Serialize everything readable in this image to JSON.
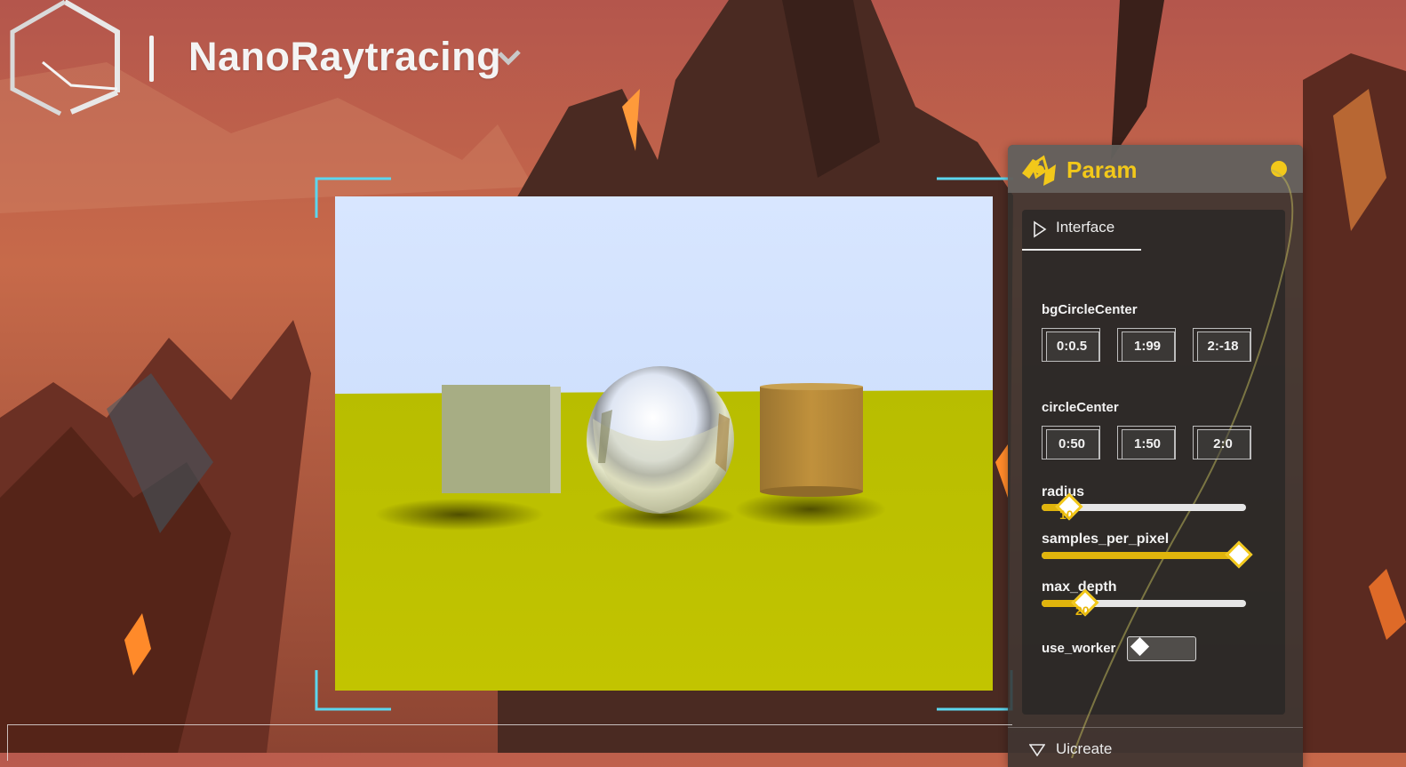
{
  "header": {
    "app_title": "NanoRaytracing",
    "logo_icon": "hexagon-logo-icon",
    "menu_icon": "chevron-down-icon"
  },
  "viewport": {
    "scene_objects": [
      "cube",
      "mirror-sphere",
      "cylinder"
    ],
    "colors": {
      "sky_top": "#d5e4ff",
      "sky_bottom": "#c2d6f8",
      "ground": "#bcc200",
      "cube": "#a6ad82",
      "cylinder": "#b58c3c",
      "frame_accent": "#5cd6ee"
    }
  },
  "param_panel": {
    "title": "Param",
    "icon": "param-node-icon",
    "accent_color": "#f2c81a",
    "tab": {
      "label": "Interface",
      "icon": "play-triangle-icon"
    },
    "bgCircleCenter": {
      "label": "bgCircleCenter",
      "values": [
        "0:0.5",
        "1:99",
        "2:-18"
      ]
    },
    "circleCenter": {
      "label": "circleCenter",
      "values": [
        "0:50",
        "1:50",
        "2:0"
      ]
    },
    "radius": {
      "label": "radius",
      "value": 10,
      "value_text": "10",
      "fraction": 0.13
    },
    "samples_per_pixel": {
      "label": "samples_per_pixel",
      "value_text": "",
      "fraction": 0.96
    },
    "max_depth": {
      "label": "max_depth",
      "value": 20,
      "value_text": "20",
      "fraction": 0.21
    },
    "use_worker": {
      "label": "use_worker",
      "on": false
    }
  },
  "collapsed_section": {
    "label": "Uicreate",
    "icon": "collapse-triangle-icon"
  }
}
